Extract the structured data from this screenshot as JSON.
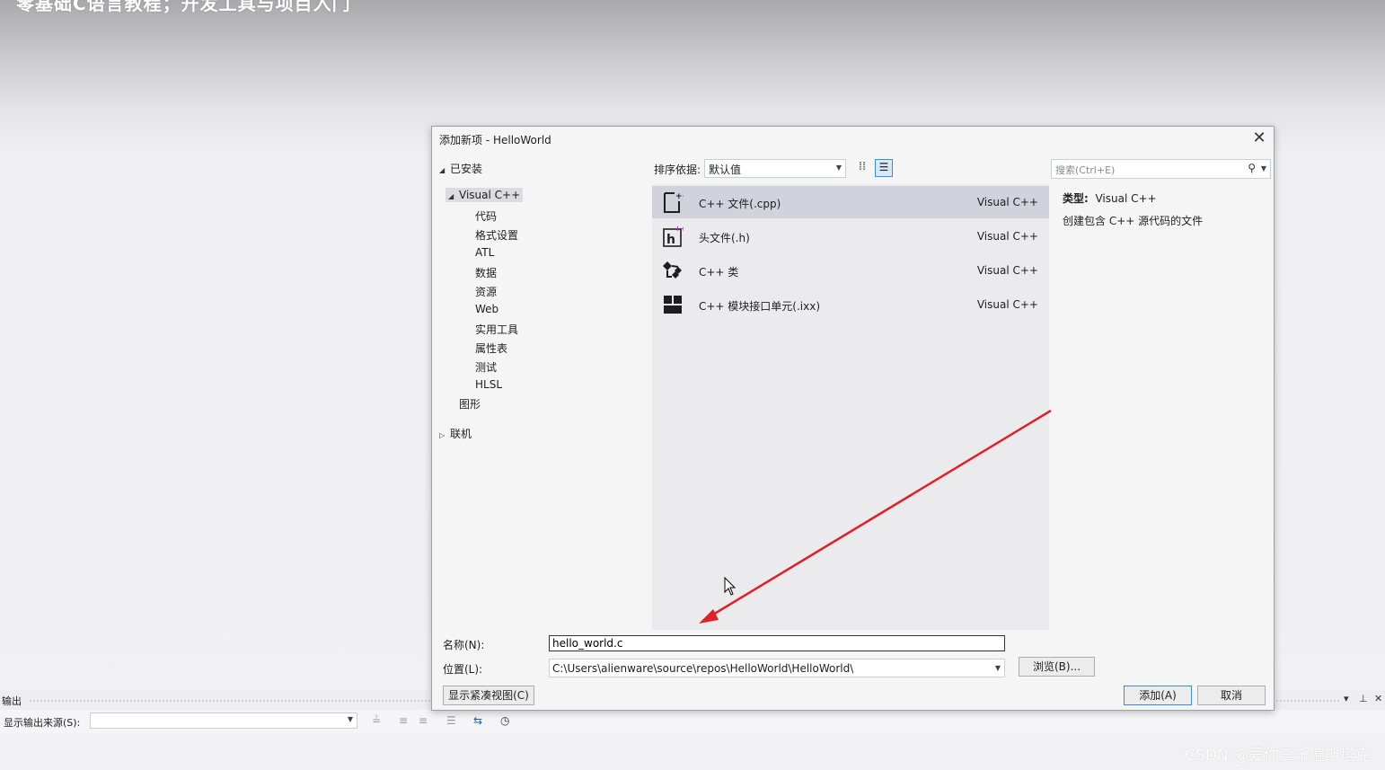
{
  "banner": "零基础C语言教程；开发工具与项目入门",
  "dialog": {
    "title": "添加新项 - HelloWorld",
    "close": "✕",
    "tree": {
      "root": "已安装",
      "selected": "Visual C++",
      "children": [
        "代码",
        "格式设置",
        "ATL",
        "数据",
        "资源",
        "Web",
        "实用工具",
        "属性表",
        "测试",
        "HLSL"
      ],
      "graphics": "图形",
      "online": "联机"
    },
    "sort": {
      "label": "排序依据:",
      "value": "默认值"
    },
    "templates": [
      {
        "icon": "cpp-file-icon",
        "name": "C++ 文件(.cpp)",
        "lang": "Visual C++"
      },
      {
        "icon": "header-file-icon",
        "name": "头文件(.h)",
        "lang": "Visual C++"
      },
      {
        "icon": "class-icon",
        "name": "C++ 类",
        "lang": "Visual C++"
      },
      {
        "icon": "module-icon",
        "name": "C++ 模块接口单元(.ixx)",
        "lang": "Visual C++"
      }
    ],
    "search": {
      "placeholder": "搜索(Ctrl+E)"
    },
    "info": {
      "type_label": "类型:",
      "type_value": "Visual C++",
      "description": "创建包含 C++ 源代码的文件"
    },
    "name": {
      "label": "名称(N):",
      "value": "hello_world.c"
    },
    "location": {
      "label": "位置(L):",
      "value": "C:\\Users\\alienware\\source\\repos\\HelloWorld\\HelloWorld\\"
    },
    "buttons": {
      "browse": "浏览(B)...",
      "compact": "显示紧凑视图(C)",
      "add": "添加(A)",
      "cancel": "取消"
    }
  },
  "output": {
    "title": "输出",
    "source_label": "显示输出来源(S):"
  },
  "annotation_color": "#e0202a",
  "watermark": "CSDN @爱你三千遍斯塔克"
}
